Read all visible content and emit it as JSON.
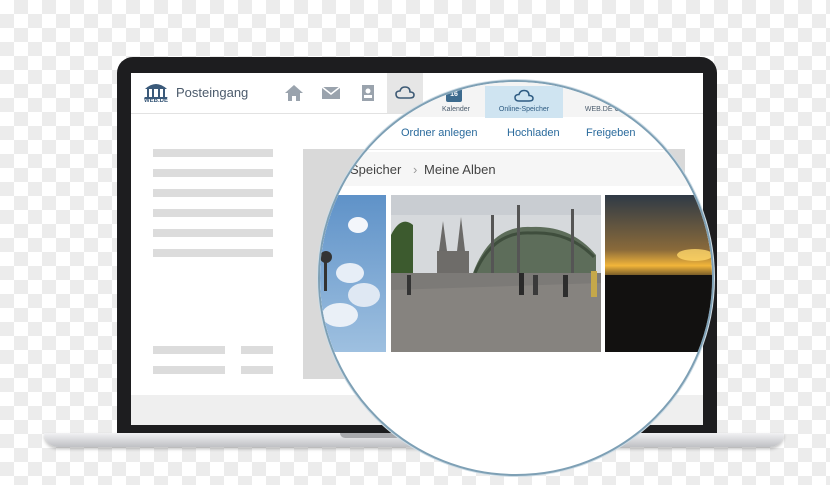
{
  "app": {
    "logo_text": "WEB.DE",
    "inbox_label": "Posteingang"
  },
  "nav": {
    "items": [
      {
        "label": "Kalender",
        "badge": "16"
      },
      {
        "label": "Online-Speicher"
      },
      {
        "label": "WEB.DE Cl"
      }
    ]
  },
  "actions": [
    "Ordner anlegen",
    "Hochladen",
    "Freigeben"
  ],
  "breadcrumb": {
    "parent": "Speicher",
    "separator": "›",
    "current": "Meine Alben"
  },
  "colors": {
    "accent": "#2a6a9c",
    "active_nav": "#cfe4f1",
    "ring": "#7ea0b5"
  }
}
